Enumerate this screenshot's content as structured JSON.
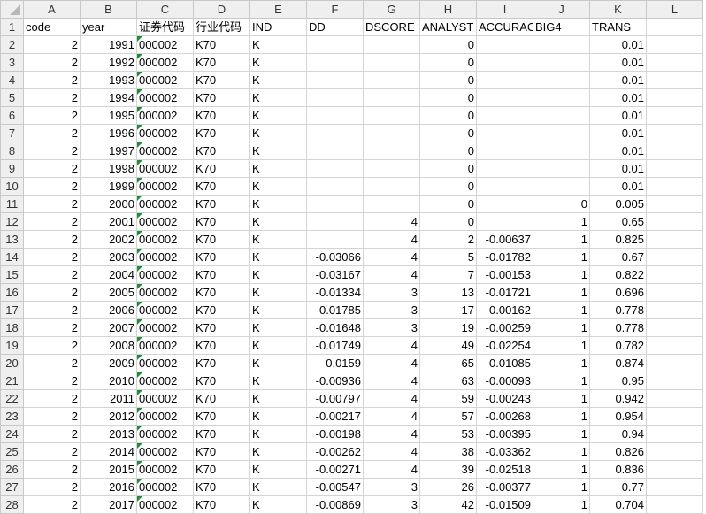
{
  "columns": [
    "A",
    "B",
    "C",
    "D",
    "E",
    "F",
    "G",
    "H",
    "I",
    "J",
    "K",
    "L"
  ],
  "headers": [
    "code",
    "year",
    "证券代码",
    "行业代码",
    "IND",
    "DD",
    "DSCORE",
    "ANALYST",
    "ACCURACY",
    "BIG4",
    "TRANS",
    ""
  ],
  "rows": [
    [
      "2",
      "1991",
      "000002",
      "K70",
      "K",
      "",
      "",
      "0",
      "",
      "",
      "0.01",
      ""
    ],
    [
      "2",
      "1992",
      "000002",
      "K70",
      "K",
      "",
      "",
      "0",
      "",
      "",
      "0.01",
      ""
    ],
    [
      "2",
      "1993",
      "000002",
      "K70",
      "K",
      "",
      "",
      "0",
      "",
      "",
      "0.01",
      ""
    ],
    [
      "2",
      "1994",
      "000002",
      "K70",
      "K",
      "",
      "",
      "0",
      "",
      "",
      "0.01",
      ""
    ],
    [
      "2",
      "1995",
      "000002",
      "K70",
      "K",
      "",
      "",
      "0",
      "",
      "",
      "0.01",
      ""
    ],
    [
      "2",
      "1996",
      "000002",
      "K70",
      "K",
      "",
      "",
      "0",
      "",
      "",
      "0.01",
      ""
    ],
    [
      "2",
      "1997",
      "000002",
      "K70",
      "K",
      "",
      "",
      "0",
      "",
      "",
      "0.01",
      ""
    ],
    [
      "2",
      "1998",
      "000002",
      "K70",
      "K",
      "",
      "",
      "0",
      "",
      "",
      "0.01",
      ""
    ],
    [
      "2",
      "1999",
      "000002",
      "K70",
      "K",
      "",
      "",
      "0",
      "",
      "",
      "0.01",
      ""
    ],
    [
      "2",
      "2000",
      "000002",
      "K70",
      "K",
      "",
      "",
      "0",
      "",
      "0",
      "0.005",
      ""
    ],
    [
      "2",
      "2001",
      "000002",
      "K70",
      "K",
      "",
      "4",
      "0",
      "",
      "1",
      "0.65",
      ""
    ],
    [
      "2",
      "2002",
      "000002",
      "K70",
      "K",
      "",
      "4",
      "2",
      "-0.00637",
      "1",
      "0.825",
      ""
    ],
    [
      "2",
      "2003",
      "000002",
      "K70",
      "K",
      "-0.03066",
      "4",
      "5",
      "-0.01782",
      "1",
      "0.67",
      ""
    ],
    [
      "2",
      "2004",
      "000002",
      "K70",
      "K",
      "-0.03167",
      "4",
      "7",
      "-0.00153",
      "1",
      "0.822",
      ""
    ],
    [
      "2",
      "2005",
      "000002",
      "K70",
      "K",
      "-0.01334",
      "3",
      "13",
      "-0.01721",
      "1",
      "0.696",
      ""
    ],
    [
      "2",
      "2006",
      "000002",
      "K70",
      "K",
      "-0.01785",
      "3",
      "17",
      "-0.00162",
      "1",
      "0.778",
      ""
    ],
    [
      "2",
      "2007",
      "000002",
      "K70",
      "K",
      "-0.01648",
      "3",
      "19",
      "-0.00259",
      "1",
      "0.778",
      ""
    ],
    [
      "2",
      "2008",
      "000002",
      "K70",
      "K",
      "-0.01749",
      "4",
      "49",
      "-0.02254",
      "1",
      "0.782",
      ""
    ],
    [
      "2",
      "2009",
      "000002",
      "K70",
      "K",
      "-0.0159",
      "4",
      "65",
      "-0.01085",
      "1",
      "0.874",
      ""
    ],
    [
      "2",
      "2010",
      "000002",
      "K70",
      "K",
      "-0.00936",
      "4",
      "63",
      "-0.00093",
      "1",
      "0.95",
      ""
    ],
    [
      "2",
      "2011",
      "000002",
      "K70",
      "K",
      "-0.00797",
      "4",
      "59",
      "-0.00243",
      "1",
      "0.942",
      ""
    ],
    [
      "2",
      "2012",
      "000002",
      "K70",
      "K",
      "-0.00217",
      "4",
      "57",
      "-0.00268",
      "1",
      "0.954",
      ""
    ],
    [
      "2",
      "2013",
      "000002",
      "K70",
      "K",
      "-0.00198",
      "4",
      "53",
      "-0.00395",
      "1",
      "0.94",
      ""
    ],
    [
      "2",
      "2014",
      "000002",
      "K70",
      "K",
      "-0.00262",
      "4",
      "38",
      "-0.03362",
      "1",
      "0.826",
      ""
    ],
    [
      "2",
      "2015",
      "000002",
      "K70",
      "K",
      "-0.00271",
      "4",
      "39",
      "-0.02518",
      "1",
      "0.836",
      ""
    ],
    [
      "2",
      "2016",
      "000002",
      "K70",
      "K",
      "-0.00547",
      "3",
      "26",
      "-0.00377",
      "1",
      "0.77",
      ""
    ],
    [
      "2",
      "2017",
      "000002",
      "K70",
      "K",
      "-0.00869",
      "3",
      "42",
      "-0.01509",
      "1",
      "0.704",
      ""
    ]
  ],
  "text_columns": [
    2,
    3,
    4
  ],
  "flag_column": 2,
  "colors": {
    "grid": "#d4d4d4",
    "header_bg": "#efefef",
    "error_flag": "#1e8c3a"
  }
}
